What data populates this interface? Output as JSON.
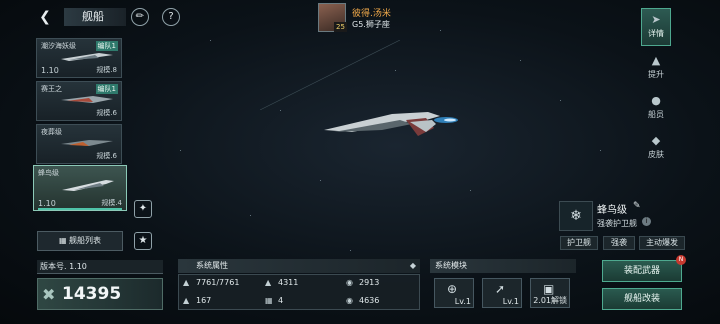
{
  "header": {
    "back_icon": "chevron-left-icon",
    "title": "舰船",
    "edit_icon": "brush-icon",
    "help_icon": "question-icon"
  },
  "player": {
    "name": "彼得.汤米",
    "level": "25",
    "rank": "G5.狮子座"
  },
  "ship_list": [
    {
      "name": "潮汐海妖级",
      "tag": "编队1",
      "version": "1.10",
      "scale": "规模.8"
    },
    {
      "name": "赛王之",
      "tag": "编队1",
      "version": "",
      "scale": "规模.6"
    },
    {
      "name": "夜葬级",
      "tag": "",
      "version": "",
      "scale": "规模.6"
    },
    {
      "name": "蜂鸟级",
      "tag": "",
      "version": "1.10",
      "scale": "规模.4"
    }
  ],
  "fleet_list_button": "舰船列表",
  "side_menu": [
    {
      "label": "详情",
      "icon": "ship-icon",
      "active": true
    },
    {
      "label": "提升",
      "icon": "upgrade-icon",
      "active": false
    },
    {
      "label": "船员",
      "icon": "crew-icon",
      "active": false
    },
    {
      "label": "皮肤",
      "icon": "skin-icon",
      "active": false
    }
  ],
  "ship_info": {
    "name": "蜂鸟级",
    "type": "强袭护卫舰",
    "roles": [
      "护卫舰",
      "强袭",
      "主动爆发"
    ]
  },
  "version": "版本号. 1.10",
  "power": "14395",
  "attributes": {
    "title": "系统属性",
    "hp": "7761/7761",
    "armor": "4311",
    "shield": "2913",
    "speed": "167",
    "slots": "4",
    "energy": "4636"
  },
  "modules": {
    "title": "系统模块",
    "items": [
      {
        "icon": "target-icon",
        "label": "Lv.1"
      },
      {
        "icon": "missile-icon",
        "label": "Lv.1"
      },
      {
        "icon": "lock-icon",
        "label": "2.01解锁"
      }
    ]
  },
  "actions": {
    "equip": "装配武器",
    "equip_badge": "N",
    "refit": "舰船改装"
  },
  "colors": {
    "accent": "#4ea98f",
    "player_name": "#f0a94a",
    "background": "#0b1218"
  }
}
